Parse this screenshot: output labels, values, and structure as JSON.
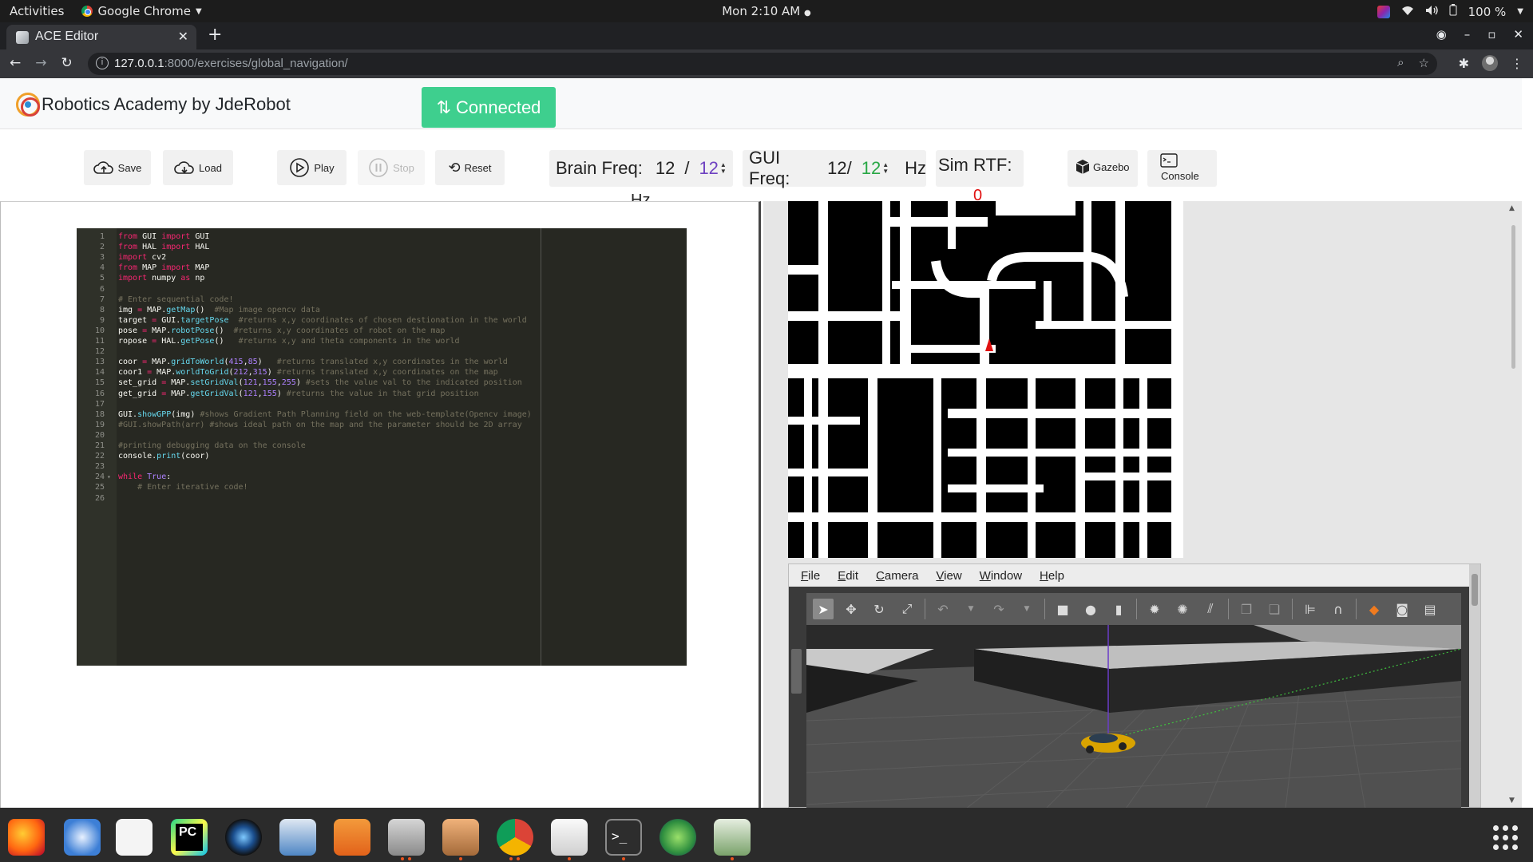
{
  "topbar": {
    "activities": "Activities",
    "app_name": "Google Chrome",
    "clock": "Mon  2:10 AM",
    "battery": "100 %"
  },
  "browser": {
    "tab_title": "ACE Editor",
    "url_host": "127.0.0.1",
    "url_path": ":8000/exercises/global_navigation/"
  },
  "header": {
    "brand": "Robotics Academy by JdeRobot",
    "connected_label": "Connected"
  },
  "toolbar": {
    "save": "Save",
    "load": "Load",
    "play": "Play",
    "stop": "Stop",
    "reset": "Reset",
    "brain_freq_label": "Brain Freq:",
    "brain_freq_value": "12",
    "brain_freq_sep": "/",
    "brain_freq_target": "12",
    "brain_freq_unit": "Hz",
    "gui_freq_label": "GUI Freq:",
    "gui_freq_value": "12/",
    "gui_freq_target": "12",
    "gui_freq_unit": "Hz",
    "sim_rtf_label": "Sim RTF:",
    "sim_rtf_value": "0",
    "gazebo": "Gazebo",
    "console": "Console"
  },
  "editor": {
    "lines": [
      {
        "n": "1",
        "html": "<span class=\"kw\">from</span> GUI <span class=\"kw\">import</span> GUI"
      },
      {
        "n": "2",
        "html": "<span class=\"kw\">from</span> HAL <span class=\"kw\">import</span> HAL"
      },
      {
        "n": "3",
        "html": "<span class=\"kw\">import</span> cv2"
      },
      {
        "n": "4",
        "html": "<span class=\"kw\">from</span> MAP <span class=\"kw\">import</span> MAP"
      },
      {
        "n": "5",
        "html": "<span class=\"kw\">import</span> numpy <span class=\"kw\">as</span> np"
      },
      {
        "n": "6",
        "html": ""
      },
      {
        "n": "7",
        "html": "<span class=\"cm\"># Enter sequential code!</span>"
      },
      {
        "n": "8",
        "html": "img <span class=\"kw\">=</span> MAP.<span class=\"fn\">getMap</span>()  <span class=\"cm\">#Map image opencv data</span>"
      },
      {
        "n": "9",
        "html": "target <span class=\"kw\">=</span> GUI.<span class=\"fn\">targetPose</span>  <span class=\"cm\">#returns x,y coordinates of chosen destionation in the world</span>"
      },
      {
        "n": "10",
        "html": "pose <span class=\"kw\">=</span> MAP.<span class=\"fn\">robotPose</span>()  <span class=\"cm\">#returns x,y coordinates of robot on the map</span>"
      },
      {
        "n": "11",
        "html": "ropose <span class=\"kw\">=</span> HAL.<span class=\"fn\">getPose</span>()   <span class=\"cm\">#returns x,y and theta components in the world</span>"
      },
      {
        "n": "12",
        "html": ""
      },
      {
        "n": "13",
        "html": "coor <span class=\"kw\">=</span> MAP.<span class=\"fn\">gridToWorld</span>(<span class=\"num\">415</span>,<span class=\"num\">85</span>)   <span class=\"cm\">#returns translated x,y coordinates in the world</span>"
      },
      {
        "n": "14",
        "html": "coor1 <span class=\"kw\">=</span> MAP.<span class=\"fn\">worldToGrid</span>(<span class=\"num\">212</span>,<span class=\"num\">315</span>) <span class=\"cm\">#returns translated x,y coordinates on the map</span>"
      },
      {
        "n": "15",
        "html": "set_grid <span class=\"kw\">=</span> MAP.<span class=\"fn\">setGridVal</span>(<span class=\"num\">121</span>,<span class=\"num\">155</span>,<span class=\"num\">255</span>) <span class=\"cm\">#sets the value val to the indicated position</span>"
      },
      {
        "n": "16",
        "html": "get_grid <span class=\"kw\">=</span> MAP.<span class=\"fn\">getGridVal</span>(<span class=\"num\">121</span>,<span class=\"num\">155</span>) <span class=\"cm\">#returns the value in that grid position</span>"
      },
      {
        "n": "17",
        "html": ""
      },
      {
        "n": "18",
        "html": "GUI.<span class=\"fn\">showGPP</span>(img) <span class=\"cm\">#shows Gradient Path Planning field on the web-template(Opencv image)</span>"
      },
      {
        "n": "19",
        "html": "<span class=\"cm\">#GUI.showPath(arr) #shows ideal path on the map and the parameter should be 2D array</span>"
      },
      {
        "n": "20",
        "html": ""
      },
      {
        "n": "21",
        "html": "<span class=\"cm\">#printing debugging data on the console</span>"
      },
      {
        "n": "22",
        "html": "console.<span class=\"fn\">print</span>(coor)"
      },
      {
        "n": "23",
        "html": ""
      },
      {
        "n": "24",
        "html": "<span class=\"kw\">while</span> <span class=\"cst\">True</span>:"
      },
      {
        "n": "25",
        "html": "    <span class=\"cm\"># Enter iterative code!</span>"
      },
      {
        "n": "26",
        "html": "    "
      }
    ]
  },
  "gazebo": {
    "menu": [
      "File",
      "Edit",
      "Camera",
      "View",
      "Window",
      "Help"
    ]
  },
  "colors": {
    "connected": "#3ecf8e",
    "editor_bg": "#272822",
    "brain_target": "#6f42c1",
    "gui_target": "#28a745",
    "rtf": "#e01010"
  }
}
